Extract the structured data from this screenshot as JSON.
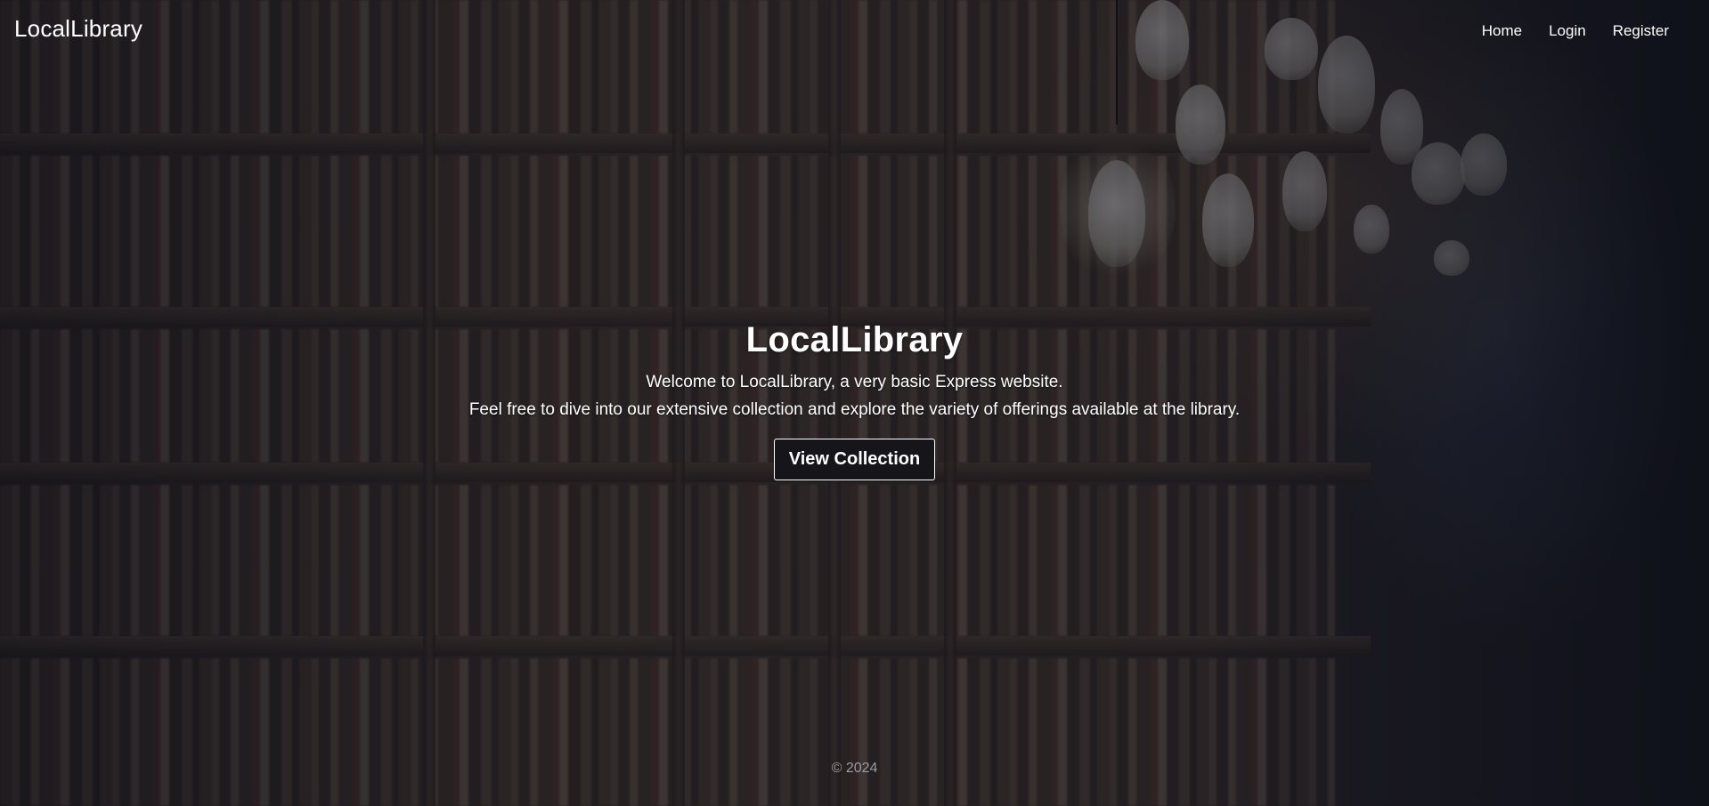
{
  "navbar": {
    "brand": "LocalLibrary",
    "links": [
      {
        "label": "Home"
      },
      {
        "label": "Login"
      },
      {
        "label": "Register"
      }
    ]
  },
  "hero": {
    "title": "LocalLibrary",
    "line1": "Welcome to LocalLibrary, a very basic Express website.",
    "line2": "Feel free to dive into our extensive collection and explore the variety of offerings available at the library.",
    "cta_label": "View Collection"
  },
  "footer": {
    "copyright": "© 2024"
  },
  "colors": {
    "overlay": "#10121e",
    "text": "#ffffff",
    "footer_text": "#9a9ba3",
    "button_bg": "#16161a"
  }
}
